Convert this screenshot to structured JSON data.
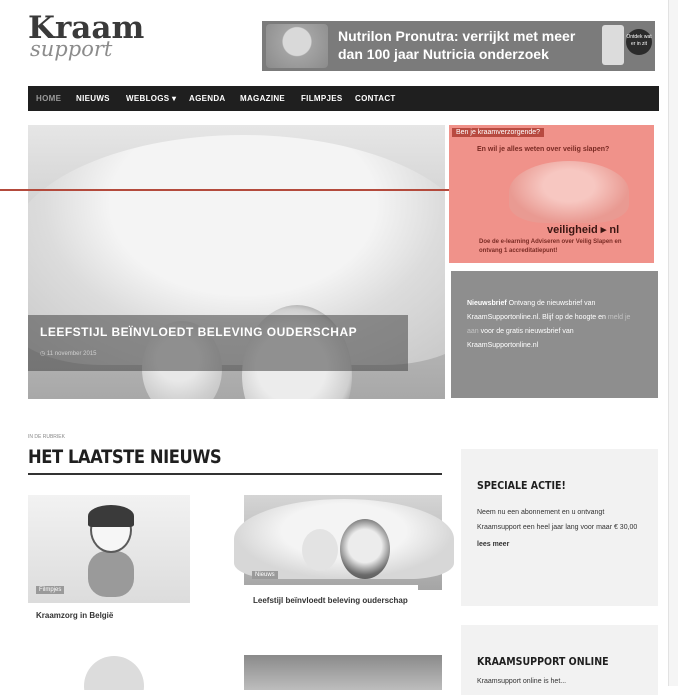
{
  "logo": {
    "main": "Kraam",
    "sub": "support"
  },
  "banner": {
    "text": "Nutrilon Pronutra: verrijkt met meer dan 100 jaar Nutricia onderzoek",
    "badge": "Ontdek wat er in zit"
  },
  "nav": {
    "items": [
      "Home",
      "Nieuws",
      "Weblogs ▾",
      "Agenda",
      "Magazine",
      "Filmpjes",
      "Contact"
    ],
    "active": "Home"
  },
  "hero": {
    "caption": "Leefstijl beïnvloedt beleving ouderschap",
    "date": "◷ 11 november 2015"
  },
  "ad": {
    "tag": "Ben je kraamverzorgende?",
    "question": "En wil je alles weten over veilig slapen?",
    "brand": "veiligheid ▸ nl",
    "footer": "Doe de e-learning Adviseren over Veilig Slapen en ontvang 1 accreditatiepunt!",
    "bg_color": "#f0928a"
  },
  "newsletter": {
    "title": "Nieuwsbrief",
    "text1": " Ontvang de nieuwsbrief van KraamSupportonline.nl. Blijf op de hoogte en ",
    "link": "meld je aan",
    "text2": " voor de gratis nieuwsbrief van KraamSupportonline.nl"
  },
  "section": {
    "label": "In de rubriek",
    "title": "HET LAATSTE NIEUWS"
  },
  "cards": [
    {
      "badge": "Filmpjes",
      "caption": "Kraamzorg in België"
    },
    {
      "badge": "Nieuws",
      "caption": "Leefstijl beïnvloedt beleving ouderschap"
    }
  ],
  "speciale": {
    "title": "SPECIALE ACTIE!",
    "body": "Neem nu een abonnement en u ontvangt Kraamsupport een heel jaar lang voor maar € 30,00",
    "link": "lees meer"
  },
  "kraamsupport": {
    "title": "KRAAMSUPPORT ONLINE",
    "body": "Kraamsupport online is het..."
  },
  "colors": {
    "nav_bg": "#1f1f1f",
    "annotation_line": "#b34a3c",
    "newsletter_bg": "#8e8e8e"
  }
}
